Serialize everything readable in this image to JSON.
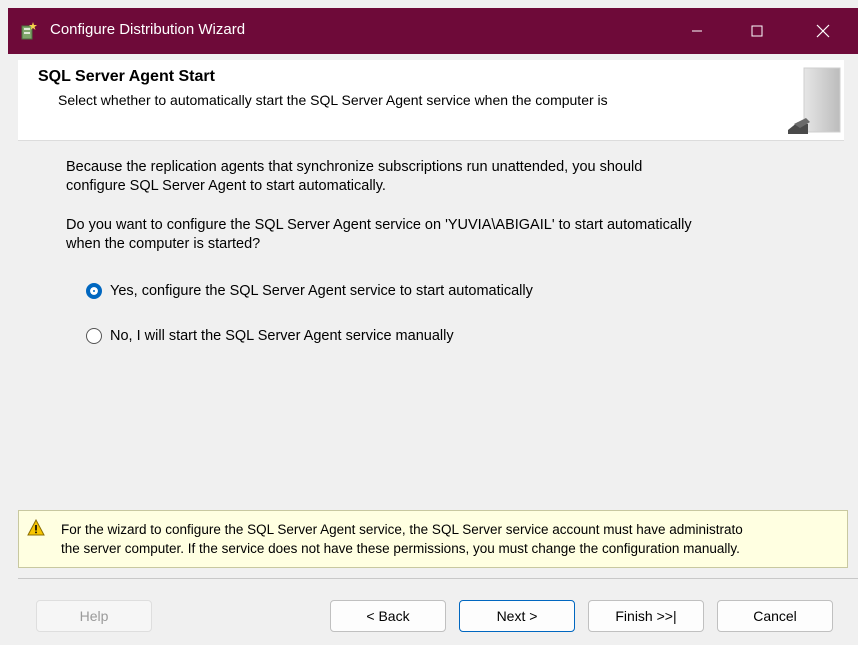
{
  "window": {
    "title": "Configure Distribution Wizard",
    "accent_color": "#6e0a39"
  },
  "header": {
    "title": "SQL Server Agent Start",
    "subtitle": "Select whether to automatically start the SQL Server Agent service when the computer is"
  },
  "body": {
    "paragraph1_line1": "Because the replication agents that synchronize subscriptions run unattended, you should",
    "paragraph1_line2": "configure SQL Server Agent to start automatically.",
    "paragraph2_line1": "Do you want to configure the SQL Server Agent service on 'YUVIA\\ABIGAIL' to start automatically",
    "paragraph2_line2": "when the computer is started?"
  },
  "options": [
    {
      "label": "Yes, configure the SQL Server Agent service to start automatically",
      "selected": true
    },
    {
      "label": "No, I will start the SQL Server Agent service manually",
      "selected": false
    }
  ],
  "warning": {
    "line1": "For the wizard to configure the SQL Server Agent service, the SQL Server service account must have administrato",
    "line2": "the server computer. If the service does not have these permissions, you must change the configuration manually.",
    "icon": "warning-icon"
  },
  "buttons": {
    "help": "Help",
    "back": "< Back",
    "next": "Next >",
    "finish": "Finish >>|",
    "cancel": "Cancel"
  }
}
